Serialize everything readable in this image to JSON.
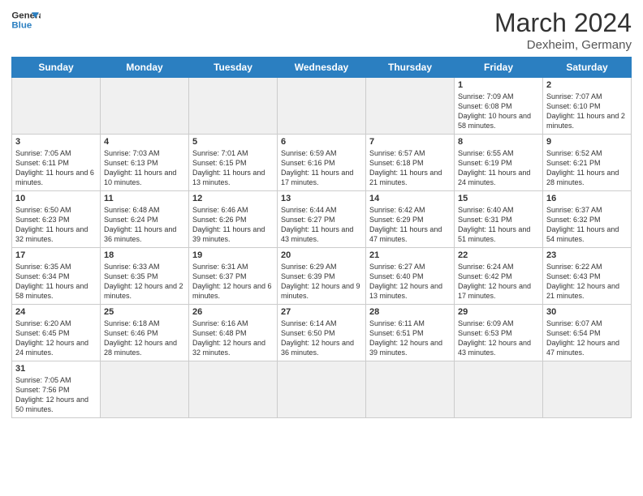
{
  "header": {
    "logo_general": "General",
    "logo_blue": "Blue",
    "title": "March 2024",
    "subtitle": "Dexheim, Germany"
  },
  "columns": [
    "Sunday",
    "Monday",
    "Tuesday",
    "Wednesday",
    "Thursday",
    "Friday",
    "Saturday"
  ],
  "weeks": [
    [
      {
        "day": "",
        "info": ""
      },
      {
        "day": "",
        "info": ""
      },
      {
        "day": "",
        "info": ""
      },
      {
        "day": "",
        "info": ""
      },
      {
        "day": "",
        "info": ""
      },
      {
        "day": "1",
        "info": "Sunrise: 7:09 AM\nSunset: 6:08 PM\nDaylight: 10 hours and 58 minutes."
      },
      {
        "day": "2",
        "info": "Sunrise: 7:07 AM\nSunset: 6:10 PM\nDaylight: 11 hours and 2 minutes."
      }
    ],
    [
      {
        "day": "3",
        "info": "Sunrise: 7:05 AM\nSunset: 6:11 PM\nDaylight: 11 hours and 6 minutes."
      },
      {
        "day": "4",
        "info": "Sunrise: 7:03 AM\nSunset: 6:13 PM\nDaylight: 11 hours and 10 minutes."
      },
      {
        "day": "5",
        "info": "Sunrise: 7:01 AM\nSunset: 6:15 PM\nDaylight: 11 hours and 13 minutes."
      },
      {
        "day": "6",
        "info": "Sunrise: 6:59 AM\nSunset: 6:16 PM\nDaylight: 11 hours and 17 minutes."
      },
      {
        "day": "7",
        "info": "Sunrise: 6:57 AM\nSunset: 6:18 PM\nDaylight: 11 hours and 21 minutes."
      },
      {
        "day": "8",
        "info": "Sunrise: 6:55 AM\nSunset: 6:19 PM\nDaylight: 11 hours and 24 minutes."
      },
      {
        "day": "9",
        "info": "Sunrise: 6:52 AM\nSunset: 6:21 PM\nDaylight: 11 hours and 28 minutes."
      }
    ],
    [
      {
        "day": "10",
        "info": "Sunrise: 6:50 AM\nSunset: 6:23 PM\nDaylight: 11 hours and 32 minutes."
      },
      {
        "day": "11",
        "info": "Sunrise: 6:48 AM\nSunset: 6:24 PM\nDaylight: 11 hours and 36 minutes."
      },
      {
        "day": "12",
        "info": "Sunrise: 6:46 AM\nSunset: 6:26 PM\nDaylight: 11 hours and 39 minutes."
      },
      {
        "day": "13",
        "info": "Sunrise: 6:44 AM\nSunset: 6:27 PM\nDaylight: 11 hours and 43 minutes."
      },
      {
        "day": "14",
        "info": "Sunrise: 6:42 AM\nSunset: 6:29 PM\nDaylight: 11 hours and 47 minutes."
      },
      {
        "day": "15",
        "info": "Sunrise: 6:40 AM\nSunset: 6:31 PM\nDaylight: 11 hours and 51 minutes."
      },
      {
        "day": "16",
        "info": "Sunrise: 6:37 AM\nSunset: 6:32 PM\nDaylight: 11 hours and 54 minutes."
      }
    ],
    [
      {
        "day": "17",
        "info": "Sunrise: 6:35 AM\nSunset: 6:34 PM\nDaylight: 11 hours and 58 minutes."
      },
      {
        "day": "18",
        "info": "Sunrise: 6:33 AM\nSunset: 6:35 PM\nDaylight: 12 hours and 2 minutes."
      },
      {
        "day": "19",
        "info": "Sunrise: 6:31 AM\nSunset: 6:37 PM\nDaylight: 12 hours and 6 minutes."
      },
      {
        "day": "20",
        "info": "Sunrise: 6:29 AM\nSunset: 6:39 PM\nDaylight: 12 hours and 9 minutes."
      },
      {
        "day": "21",
        "info": "Sunrise: 6:27 AM\nSunset: 6:40 PM\nDaylight: 12 hours and 13 minutes."
      },
      {
        "day": "22",
        "info": "Sunrise: 6:24 AM\nSunset: 6:42 PM\nDaylight: 12 hours and 17 minutes."
      },
      {
        "day": "23",
        "info": "Sunrise: 6:22 AM\nSunset: 6:43 PM\nDaylight: 12 hours and 21 minutes."
      }
    ],
    [
      {
        "day": "24",
        "info": "Sunrise: 6:20 AM\nSunset: 6:45 PM\nDaylight: 12 hours and 24 minutes."
      },
      {
        "day": "25",
        "info": "Sunrise: 6:18 AM\nSunset: 6:46 PM\nDaylight: 12 hours and 28 minutes."
      },
      {
        "day": "26",
        "info": "Sunrise: 6:16 AM\nSunset: 6:48 PM\nDaylight: 12 hours and 32 minutes."
      },
      {
        "day": "27",
        "info": "Sunrise: 6:14 AM\nSunset: 6:50 PM\nDaylight: 12 hours and 36 minutes."
      },
      {
        "day": "28",
        "info": "Sunrise: 6:11 AM\nSunset: 6:51 PM\nDaylight: 12 hours and 39 minutes."
      },
      {
        "day": "29",
        "info": "Sunrise: 6:09 AM\nSunset: 6:53 PM\nDaylight: 12 hours and 43 minutes."
      },
      {
        "day": "30",
        "info": "Sunrise: 6:07 AM\nSunset: 6:54 PM\nDaylight: 12 hours and 47 minutes."
      }
    ],
    [
      {
        "day": "31",
        "info": "Sunrise: 7:05 AM\nSunset: 7:56 PM\nDaylight: 12 hours and 50 minutes."
      },
      {
        "day": "",
        "info": ""
      },
      {
        "day": "",
        "info": ""
      },
      {
        "day": "",
        "info": ""
      },
      {
        "day": "",
        "info": ""
      },
      {
        "day": "",
        "info": ""
      },
      {
        "day": "",
        "info": ""
      }
    ]
  ]
}
